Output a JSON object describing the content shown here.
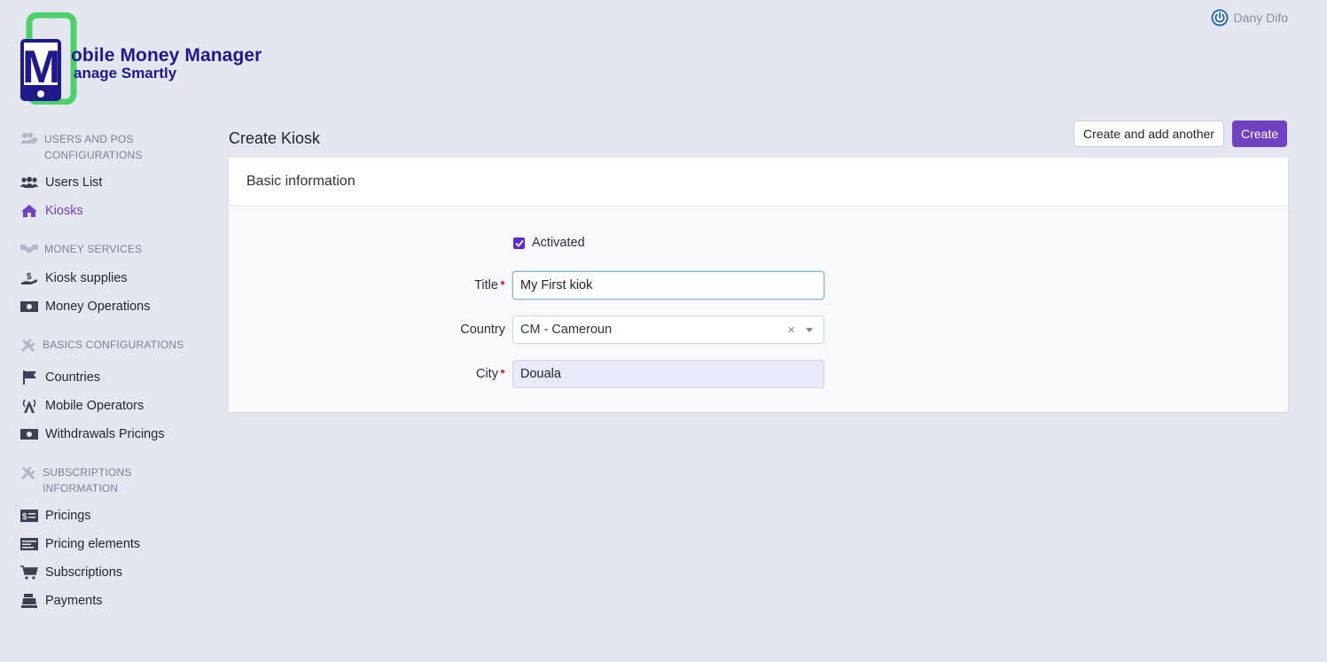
{
  "brand": {
    "line1": "obile Money Manager",
    "line2": "anage Smartly",
    "monogram": "M",
    "colors": {
      "dark": "#1e1a8c",
      "green": "#4cd16a"
    }
  },
  "user": {
    "name": "Dany Difo",
    "icon": "power-icon"
  },
  "sidebar": {
    "sections": [
      {
        "title": "USERS AND POS CONFIGURATIONS",
        "icon": "users-cog-icon",
        "items": [
          {
            "label": "Users List",
            "icon": "users-icon"
          },
          {
            "label": "Kiosks",
            "icon": "home-icon",
            "active": true
          }
        ]
      },
      {
        "title": "MONEY SERVICES",
        "icon": "handshake-icon",
        "items": [
          {
            "label": "Kiosk supplies",
            "icon": "hand-coin-icon"
          },
          {
            "label": "Money Operations",
            "icon": "money-bill-icon"
          }
        ]
      },
      {
        "title": "BASICS CONFIGURATIONS",
        "icon": "tools-icon",
        "items": [
          {
            "label": "Countries",
            "icon": "flag-icon"
          },
          {
            "label": "Mobile Operators",
            "icon": "broadcast-tower-icon"
          },
          {
            "label": "Withdrawals Pricings",
            "icon": "money-bill-icon"
          }
        ]
      },
      {
        "title": "SUBSCRIPTIONS INFORMATION",
        "icon": "tools-icon",
        "items": [
          {
            "label": "Pricings",
            "icon": "dollar-list-icon"
          },
          {
            "label": "Pricing elements",
            "icon": "list-card-icon"
          },
          {
            "label": "Subscriptions",
            "icon": "cart-icon"
          },
          {
            "label": "Payments",
            "icon": "cash-register-icon"
          }
        ]
      }
    ]
  },
  "page": {
    "title": "Create Kiosk"
  },
  "actions": {
    "create_another": "Create and add another",
    "create": "Create"
  },
  "form": {
    "section_title": "Basic information",
    "activated": {
      "label": "Activated",
      "checked": true
    },
    "title": {
      "label": "Title",
      "value": "My First kiok",
      "required": true
    },
    "country": {
      "label": "Country",
      "value": "CM - Cameroun",
      "clear": "×"
    },
    "city": {
      "label": "City",
      "value": "Douala",
      "required": true
    }
  },
  "colors": {
    "primary": "#6f42c1",
    "background": "#e4e6ef"
  }
}
